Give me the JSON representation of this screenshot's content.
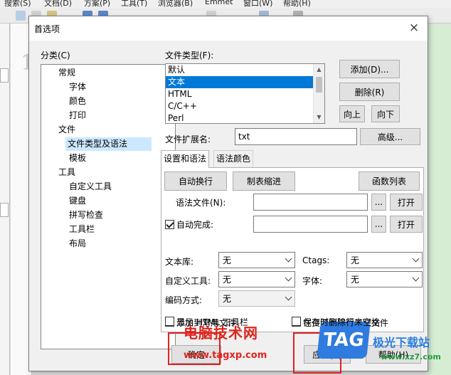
{
  "menubar": {
    "items": [
      "搜索(S)",
      "文档(D)",
      "方案(P)",
      "工具(T)",
      "浏览器(B)",
      "Emmet",
      "窗口(W)",
      "帮助(H)"
    ]
  },
  "editor": {
    "line_number": "1"
  },
  "dialog": {
    "title": "首选项",
    "close": "×"
  },
  "category": {
    "label": "分类(C)",
    "nodes": [
      "常规",
      "字体",
      "颜色",
      "打印",
      "文件",
      "文件类型及语法",
      "模板",
      "工具",
      "自定义工具",
      "键盘",
      "拼写检查",
      "工具栏",
      "布局"
    ],
    "selected": "文件类型及语法"
  },
  "file_types": {
    "label": "文件类型(F):",
    "items": [
      "默认",
      "文本",
      "HTML",
      "C/C++",
      "Perl"
    ],
    "selected": "文本"
  },
  "buttons": {
    "add": "添加(D)...",
    "delete": "删除(R)",
    "up": "向上",
    "down": "向下",
    "advanced": "高级...",
    "auto_wrap": "自动换行",
    "tab_indent": "制表缩进",
    "func_list": "函数列表",
    "browse": "...",
    "open": "打开",
    "ok": "确定",
    "apply": "应用(A)",
    "help": "帮助(H)"
  },
  "extension": {
    "label": "文件扩展名:",
    "value": "txt"
  },
  "tabs": [
    "设置和语法",
    "语法颜色"
  ],
  "syntax_file": {
    "label": "语法文件(N):",
    "value": ""
  },
  "autocomplete": {
    "label": "自动完成:",
    "checked": true,
    "value": ""
  },
  "selects": {
    "library": {
      "label": "文本库:",
      "value": "无"
    },
    "ctags": {
      "label": "Ctags:",
      "value": "无"
    },
    "custom_tools": {
      "label": "自定义工具:",
      "value": "无"
    },
    "font": {
      "label": "字体:",
      "value": "无"
    },
    "encoding": {
      "label": "编码方式:",
      "value": "无"
    }
  },
  "checkboxes": {
    "add_common": {
      "label": "添加到常用文件",
      "checked": false
    },
    "explorer_assoc": {
      "label": "在资源管理器关联文件",
      "checked": true
    },
    "show_html_toolbar": {
      "label": "显示 HTML 工具栏",
      "checked": false
    },
    "trim_trailing": {
      "label": "保存时删除行末空格",
      "checked": false
    }
  },
  "watermark": {
    "site_name": "电脑技术网",
    "site_url": "www.tagxp.com",
    "logo_text": "TAG",
    "logo_side_text": "极光下载站",
    "logo_side_url": "www.xz7.com"
  },
  "colors": {
    "selection": "#0078d7",
    "tree_selection": "#cce8ff",
    "highlight_box": "#e02020",
    "watermark_red": "#e0241c",
    "logo_blue": "#2f7be0",
    "editor_green": "#d6ecd3"
  }
}
